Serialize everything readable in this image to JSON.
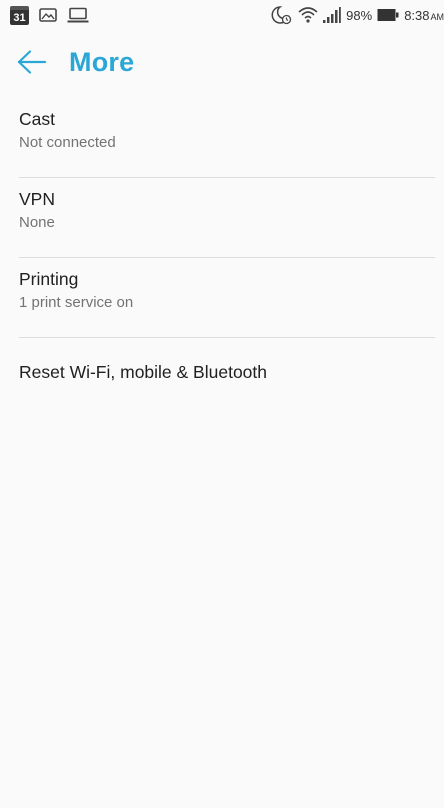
{
  "status_bar": {
    "calendar_day": "31",
    "icons_left": [
      "calendar-icon",
      "image-icon",
      "laptop-icon"
    ],
    "icons_right": [
      "do-not-disturb-alarm-icon",
      "wifi-icon",
      "signal-icon",
      "battery-icon"
    ],
    "battery": "98%",
    "time": "8:38",
    "time_suffix": "AM"
  },
  "header": {
    "back_icon": "arrow-back-icon",
    "title": "More",
    "accent_color": "#2aa7d5"
  },
  "settings": {
    "items": [
      {
        "title": "Cast",
        "summary": "Not connected"
      },
      {
        "title": "VPN",
        "summary": "None"
      },
      {
        "title": "Printing",
        "summary": "1 print service on"
      },
      {
        "title": "Reset Wi-Fi, mobile & Bluetooth"
      }
    ]
  }
}
